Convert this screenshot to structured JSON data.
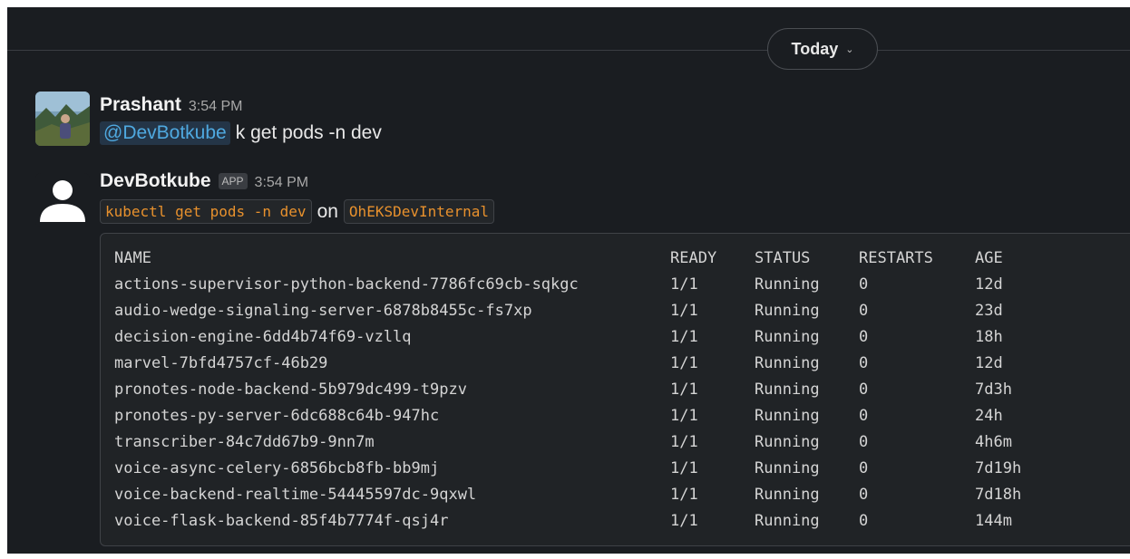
{
  "date_divider": {
    "label": "Today",
    "chevron_icon": "chevron-down-icon"
  },
  "messages": [
    {
      "sender": "Prashant",
      "time": "3:54 PM",
      "avatar": "user-photo-avatar",
      "mention": "@DevBotkube",
      "text": "k get pods -n dev"
    },
    {
      "sender": "DevBotkube",
      "badge": "APP",
      "time": "3:54 PM",
      "avatar": "default-user-avatar",
      "command": "kubectl get pods -n dev",
      "connector": "on",
      "cluster": "OhEKSDevInternal"
    }
  ],
  "pods_table": {
    "headers": [
      "NAME",
      "READY",
      "STATUS",
      "RESTARTS",
      "AGE"
    ],
    "rows": [
      [
        "actions-supervisor-python-backend-7786fc69cb-sqkgc",
        "1/1",
        "Running",
        "0",
        "12d"
      ],
      [
        "audio-wedge-signaling-server-6878b8455c-fs7xp",
        "1/1",
        "Running",
        "0",
        "23d"
      ],
      [
        "decision-engine-6dd4b74f69-vzllq",
        "1/1",
        "Running",
        "0",
        "18h"
      ],
      [
        "marvel-7bfd4757cf-46b29",
        "1/1",
        "Running",
        "0",
        "12d"
      ],
      [
        "pronotes-node-backend-5b979dc499-t9pzv",
        "1/1",
        "Running",
        "0",
        "7d3h"
      ],
      [
        "pronotes-py-server-6dc688c64b-947hc",
        "1/1",
        "Running",
        "0",
        "24h"
      ],
      [
        "transcriber-84c7dd67b9-9nn7m",
        "1/1",
        "Running",
        "0",
        "4h6m"
      ],
      [
        "voice-async-celery-6856bcb8fb-bb9mj",
        "1/1",
        "Running",
        "0",
        "7d19h"
      ],
      [
        "voice-backend-realtime-54445597dc-9qxwl",
        "1/1",
        "Running",
        "0",
        "7d18h"
      ],
      [
        "voice-flask-backend-85f4b7774f-qsj4r",
        "1/1",
        "Running",
        "0",
        "144m"
      ]
    ]
  }
}
